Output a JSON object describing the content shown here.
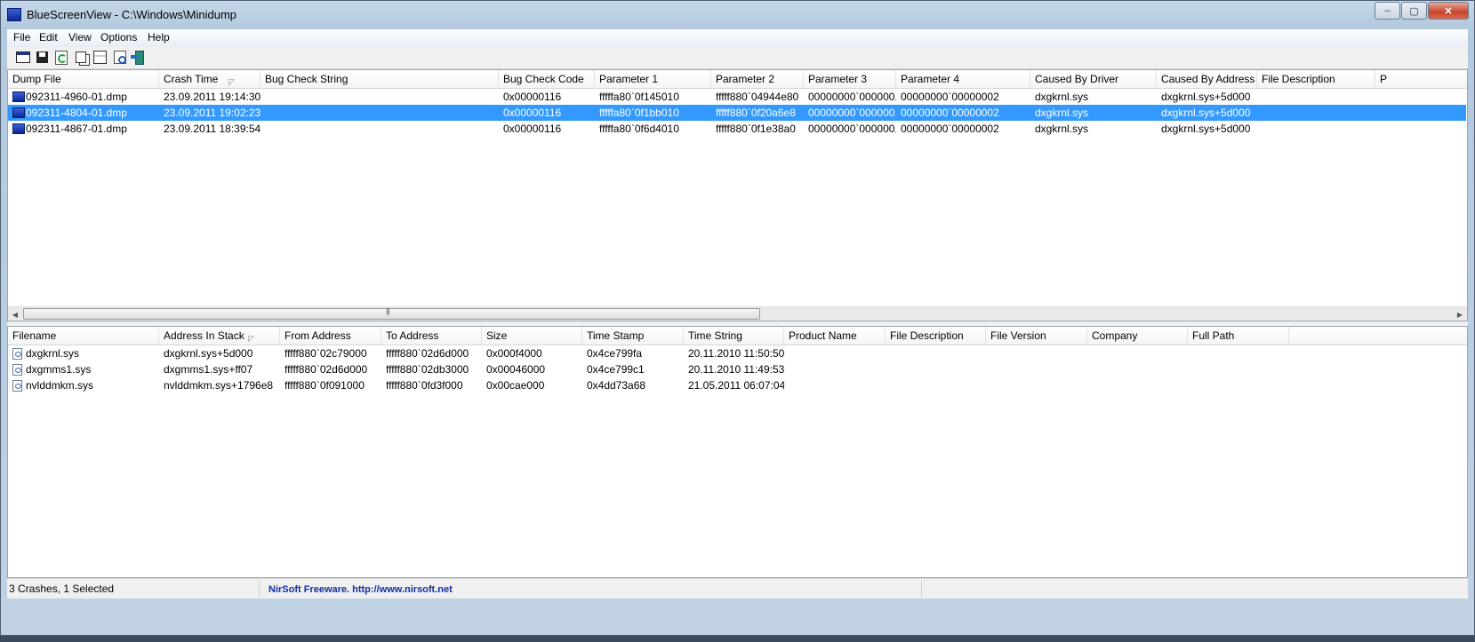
{
  "window": {
    "title": "BlueScreenView  -  C:\\Windows\\Minidump",
    "controls": {
      "minimize": "‒",
      "maximize": "▢",
      "close": "✕"
    }
  },
  "menu": [
    "File",
    "Edit",
    "View",
    "Options",
    "Help"
  ],
  "toolbar": {
    "icons": [
      "properties-icon",
      "save-icon",
      "refresh-icon",
      "copy-icon",
      "html-report-icon",
      "find-icon",
      "exit-icon"
    ]
  },
  "crashes": {
    "columns": [
      "Dump File",
      "Crash Time",
      "Bug Check String",
      "Bug Check Code",
      "Parameter 1",
      "Parameter 2",
      "Parameter 3",
      "Parameter 4",
      "Caused By Driver",
      "Caused By Address",
      "File Description",
      "P"
    ],
    "sort_indicator": "◸",
    "rows": [
      [
        "092311-4960-01.dmp",
        "23.09.2011 19:14:30",
        "",
        "0x00000116",
        "fffffa80`0f145010",
        "fffff880`04944e80",
        "00000000`000000...",
        "00000000`00000002",
        "dxgkrnl.sys",
        "dxgkrnl.sys+5d000",
        ""
      ],
      [
        "092311-4804-01.dmp",
        "23.09.2011 19:02:23",
        "",
        "0x00000116",
        "fffffa80`0f1bb010",
        "fffff880`0f20a6e8",
        "00000000`000000...",
        "00000000`00000002",
        "dxgkrnl.sys",
        "dxgkrnl.sys+5d000",
        ""
      ],
      [
        "092311-4867-01.dmp",
        "23.09.2011 18:39:54",
        "",
        "0x00000116",
        "fffffa80`0f6d4010",
        "fffff880`0f1e38a0",
        "00000000`000000...",
        "00000000`00000002",
        "dxgkrnl.sys",
        "dxgkrnl.sys+5d000",
        ""
      ]
    ],
    "selected_index": 1
  },
  "scroll": {
    "left": "◀",
    "right": "▶"
  },
  "drivers": {
    "columns": [
      "Filename",
      "Address In Stack",
      "From Address",
      "To Address",
      "Size",
      "Time Stamp",
      "Time String",
      "Product Name",
      "File Description",
      "File Version",
      "Company",
      "Full Path"
    ],
    "sort_indicator": "◸",
    "rows": [
      [
        "dxgkrnl.sys",
        "dxgkrnl.sys+5d000",
        "fffff880`02c79000",
        "fffff880`02d6d000",
        "0x000f4000",
        "0x4ce799fa",
        "20.11.2010 11:50:50",
        "",
        "",
        "",
        "",
        ""
      ],
      [
        "dxgmms1.sys",
        "dxgmms1.sys+ff07",
        "fffff880`02d6d000",
        "fffff880`02db3000",
        "0x00046000",
        "0x4ce799c1",
        "20.11.2010 11:49:53",
        "",
        "",
        "",
        "",
        ""
      ],
      [
        "nvlddmkm.sys",
        "nvlddmkm.sys+1796e8",
        "fffff880`0f091000",
        "fffff880`0fd3f000",
        "0x00cae000",
        "0x4dd73a68",
        "21.05.2011 06:07:04",
        "",
        "",
        "",
        "",
        ""
      ]
    ]
  },
  "status": {
    "summary": "3 Crashes, 1 Selected",
    "link": "NirSoft Freeware.  http://www.nirsoft.net"
  }
}
